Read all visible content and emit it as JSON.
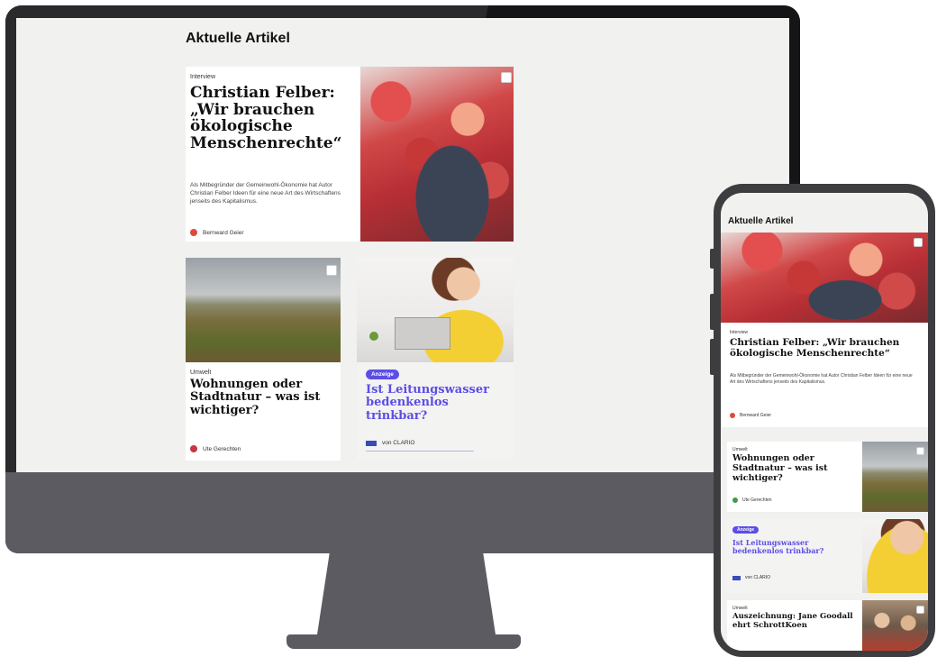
{
  "desktop": {
    "heading": "Aktuelle Artikel",
    "featured": {
      "kicker": "Interview",
      "title": "Christian Felber: „Wir brauchen ökologische Menschenrechte“",
      "teaser": "Als Mitbegründer der Gemeinwohl-Ökonomie hat Autor Christian Felber Ideen für eine neue Art des Wirtschaftens jenseits des Kapitalismus.",
      "author": "Bernward Geier"
    },
    "card2": {
      "kicker": "Umwelt",
      "title": "Wohnungen oder Stadtnatur – was ist wichtiger?",
      "author": "Ute Gerechten"
    },
    "card3": {
      "badge": "Anzeige",
      "title": "Ist Leitungswasser bedenkenlos trinkbar?",
      "author": "von CLARIO"
    }
  },
  "mobile": {
    "heading": "Aktuelle Artikel",
    "featured": {
      "kicker": "Interview",
      "title": "Christian Felber: „Wir brauchen ökologische Menschenrechte“",
      "teaser": "Als Mitbegründer der Gemeinwohl-Ökonomie hat Autor Christian Felber Ideen für eine neue Art des Wirtschaftens jenseits des Kapitalismus.",
      "author": "Bernward Geier"
    },
    "card2": {
      "kicker": "Umwelt",
      "title": "Wohnungen oder Stadtnatur – was ist wichtiger?",
      "author": "Ute Gerechten"
    },
    "card3": {
      "badge": "Anzeige",
      "title": "Ist Leitungswasser bedenkenlos trinkbar?",
      "author": "von CLARIO"
    },
    "card4": {
      "kicker": "Umwelt",
      "title": "Auszeichnung: Jane Goodall ehrt SchrottKoen"
    }
  },
  "colors": {
    "accent": "#5b4de6",
    "background": "#f1f1f0",
    "device": "#5d5b62"
  }
}
